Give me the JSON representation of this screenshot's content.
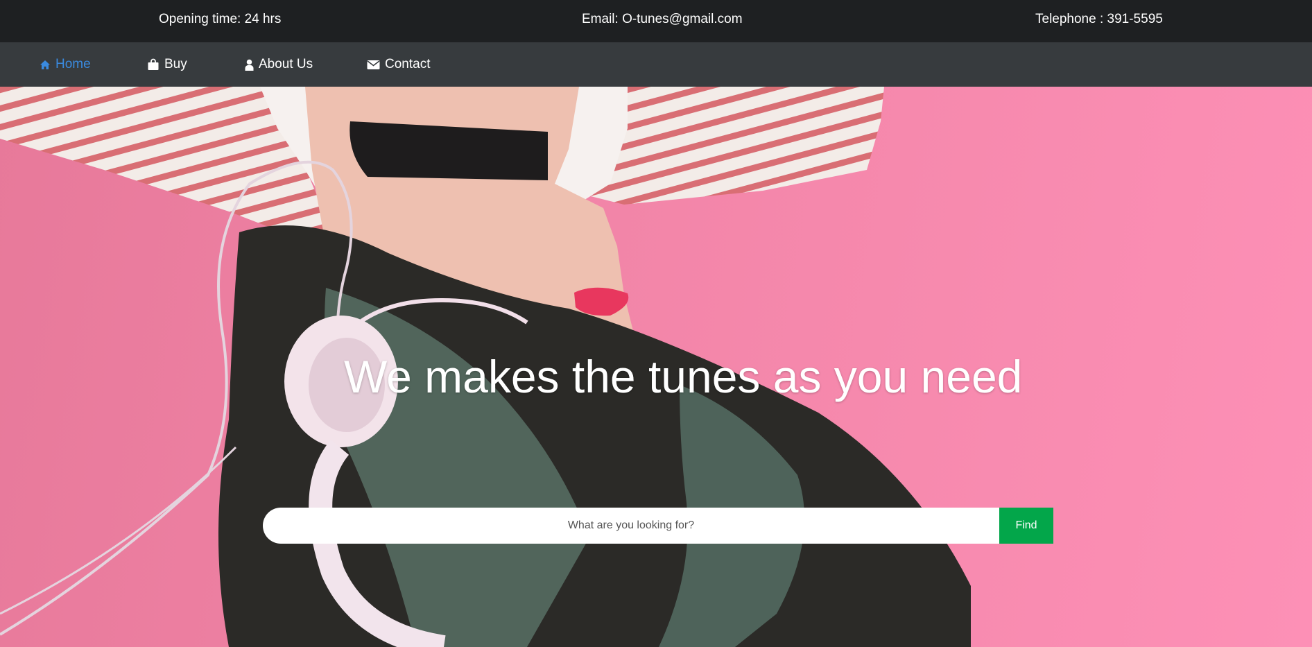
{
  "topbar": {
    "opening_time": "Opening time: 24 hrs",
    "email": "Email: O-tunes@gmail.com",
    "telephone": "Telephone : 391-5595"
  },
  "nav": {
    "home": "Home",
    "buy": "Buy",
    "about": "About Us",
    "contact": "Contact",
    "active_color": "#3a8be0"
  },
  "hero": {
    "headline": "We makes the tunes as you need",
    "search_placeholder": "What are you looking for?",
    "find_label": "Find",
    "find_color": "#03a64a"
  },
  "icons": {
    "home": "home-icon",
    "buy": "shopping-bag-icon",
    "about": "user-icon",
    "contact": "envelope-icon"
  }
}
